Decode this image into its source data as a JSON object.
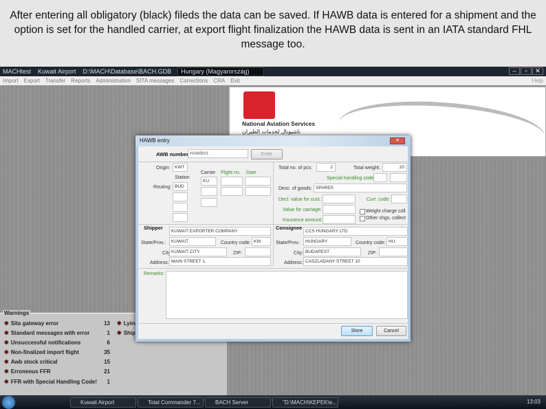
{
  "caption": "After entering all obligatory (black) fileds the data can be saved. If HAWB data is entered for a shipment and the option is set for the handled carrier, at export flight finalization the HAWB data is sent in an IATA standard FHL message too.",
  "app": {
    "title": [
      "MACHtest",
      "Kuwait Airport",
      "D:\\MACH\\Database\\BACH.GDB"
    ],
    "language": "Hungary (Magyarország)",
    "menu": [
      "Import",
      "Export",
      "Transfer",
      "Reports",
      "Administration",
      "SITA messages",
      "Corrections",
      "CRA",
      "Exit"
    ],
    "help": "Help"
  },
  "logo": {
    "name": "National Aviation Services",
    "arabic": "ناشيونال لخدمات الطيران"
  },
  "warnings": {
    "title": "Warnings",
    "items": [
      {
        "label": "Sita gateway error",
        "count": "13"
      },
      {
        "label": "Standard messages with error",
        "count": "1"
      },
      {
        "label": "Unsuccessful notifications",
        "count": "6"
      },
      {
        "label": "Non-finalized import flight",
        "count": "35"
      },
      {
        "label": "Awb stock critical",
        "count": "15"
      },
      {
        "label": "Erroneous FFR",
        "count": "21"
      },
      {
        "label": "FFR with Special Handling Code!",
        "count": "1"
      }
    ],
    "right": [
      "Lying",
      "Shipm"
    ]
  },
  "dialog": {
    "title": "HAWB entry",
    "awb_label": "AWB numbers",
    "awb_value": "HAWB01",
    "enter": "Enter",
    "origin_label": "Origin:",
    "origin": "KWT",
    "station_label": "Station",
    "routing_label": "Routing:",
    "routing": "BUD",
    "carrier_label": "Carrier",
    "flight_label": "Flight no.",
    "date_label": "Date",
    "carrier": "KU",
    "pcs_label": "Total no. of pcs:",
    "pcs": "2",
    "weight_label": "Total weight:",
    "weight": "20",
    "shc_label": "Special handling codes:",
    "goods_label": "Desc. of goods:",
    "goods": "SPARES",
    "customs_label": "Decl. value for cust.:",
    "curr_label": "Curr. code:",
    "carriage_label": "Value for carriage:",
    "insurance_label": "Insurance amount:",
    "wcc": "Weight charge coll.",
    "occ": "Other chgs. collect",
    "shipper": {
      "title": "Shipper",
      "name": "KUWAIT EXPORTER COMPANY",
      "state_label": "State/Prov.:",
      "state": "KUWAIT",
      "cc_label": "Country code:",
      "cc": "KW",
      "city_label": "City:",
      "city": "KUWAIT CITY",
      "zip_label": "ZIP:",
      "addr_label": "Address:",
      "addr": "MAIN STREET 1."
    },
    "consignee": {
      "title": "Consignee",
      "name": "CCS HUNGARY LTD",
      "state_label": "State/Prov.:",
      "state": "HUNGARY",
      "cc_label": "Country code:",
      "cc": "HU",
      "city_label": "City:",
      "city": "BUDAPEST",
      "zip_label": "ZIP:",
      "addr_label": "Address:",
      "addr": "CASZLADANY STREET 10"
    },
    "remarks_label": "Remarks:",
    "store": "Store",
    "cancel": "Cancel"
  },
  "taskbar": {
    "items": [
      "Kuwait Airport",
      "Total Commander 7...",
      "BACH Server",
      "\"D:\\MACH\\KEPEK\\e..."
    ],
    "clock": "13:03"
  }
}
